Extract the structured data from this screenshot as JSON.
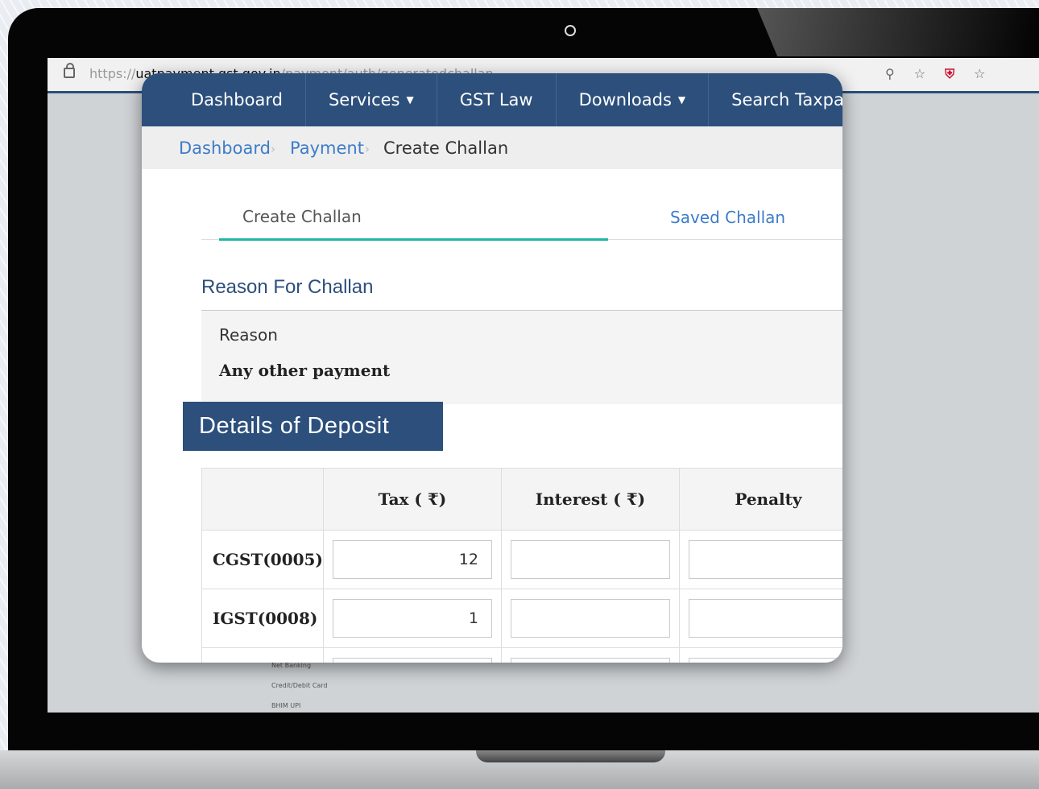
{
  "browser": {
    "url_protocol": "https://",
    "url_host": "uatpayment.gst.gov.in",
    "url_path": "/payment/auth/generatedchallan"
  },
  "background_panel": {
    "items": [
      "Net Banking",
      "Credit/Debit Card",
      "BHIM UPI"
    ]
  },
  "nav": {
    "items": [
      {
        "label": "Dashboard"
      },
      {
        "label": "Services",
        "dropdown": true
      },
      {
        "label": "GST Law"
      },
      {
        "label": "Downloads",
        "dropdown": true
      },
      {
        "label": "Search Taxpayer"
      }
    ]
  },
  "breadcrumb": {
    "items": [
      "Dashboard",
      "Payment"
    ],
    "current": "Create Challan"
  },
  "tabs": {
    "create": "Create Challan",
    "saved": "Saved Challan"
  },
  "reason": {
    "heading": "Reason For Challan",
    "label": "Reason",
    "value": "Any other payment"
  },
  "deposit": {
    "heading": "Details of Deposit",
    "columns": [
      "Tax ( ₹)",
      "Interest ( ₹)",
      "Penalty"
    ],
    "rows": [
      {
        "label": "CGST(0005)",
        "tax": "12",
        "interest": "",
        "penalty": ""
      },
      {
        "label": "IGST(0008)",
        "tax": "1",
        "interest": "",
        "penalty": ""
      }
    ]
  },
  "colors": {
    "nav_bg": "#2c4f7c",
    "tab_active": "#1fb5a8",
    "link": "#3d7cc9"
  }
}
